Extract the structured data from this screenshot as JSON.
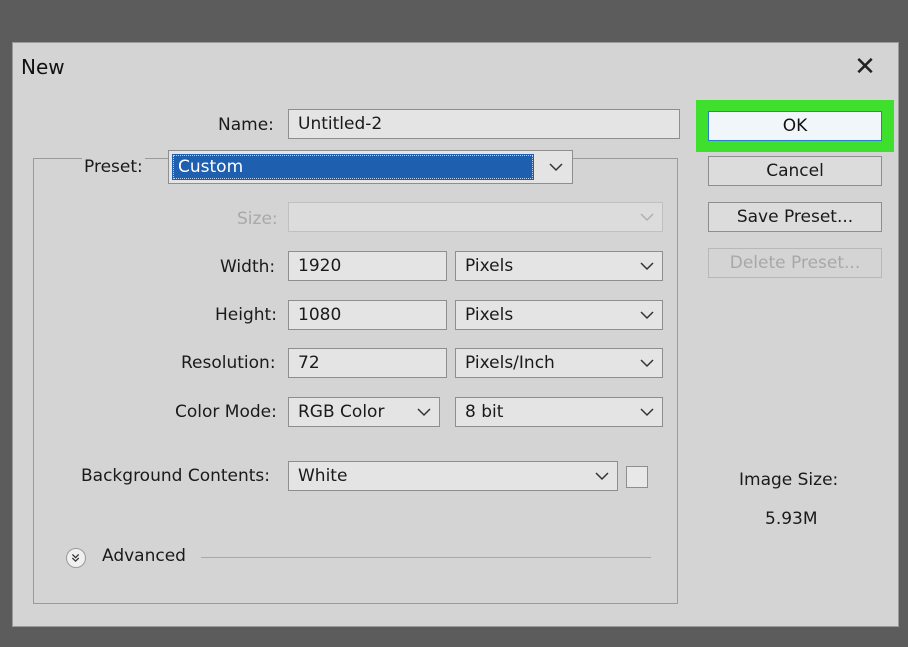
{
  "dialog": {
    "title": "New",
    "close_glyph": "✕"
  },
  "form": {
    "name": {
      "label": "Name:",
      "value": "Untitled-2"
    },
    "preset": {
      "label": "Preset:",
      "value": "Custom"
    },
    "size": {
      "label": "Size:",
      "value": ""
    },
    "width": {
      "label": "Width:",
      "value": "1920",
      "unit": "Pixels"
    },
    "height": {
      "label": "Height:",
      "value": "1080",
      "unit": "Pixels"
    },
    "resolution": {
      "label": "Resolution:",
      "value": "72",
      "unit": "Pixels/Inch"
    },
    "color_mode": {
      "label": "Color Mode:",
      "mode": "RGB Color",
      "depth": "8 bit"
    },
    "background": {
      "label": "Background Contents:",
      "value": "White"
    },
    "advanced": {
      "label": "Advanced"
    }
  },
  "buttons": {
    "ok": "OK",
    "cancel": "Cancel",
    "save_preset": "Save Preset...",
    "delete_preset": "Delete Preset..."
  },
  "image_size": {
    "label": "Image Size:",
    "value": "5.93M"
  },
  "colors": {
    "highlight": "#3ee02d",
    "selection": "#1e5fb0"
  },
  "icons": {
    "close": "close-icon",
    "dropdown": "chevron-down-icon",
    "advanced": "double-chevron-down-icon"
  }
}
